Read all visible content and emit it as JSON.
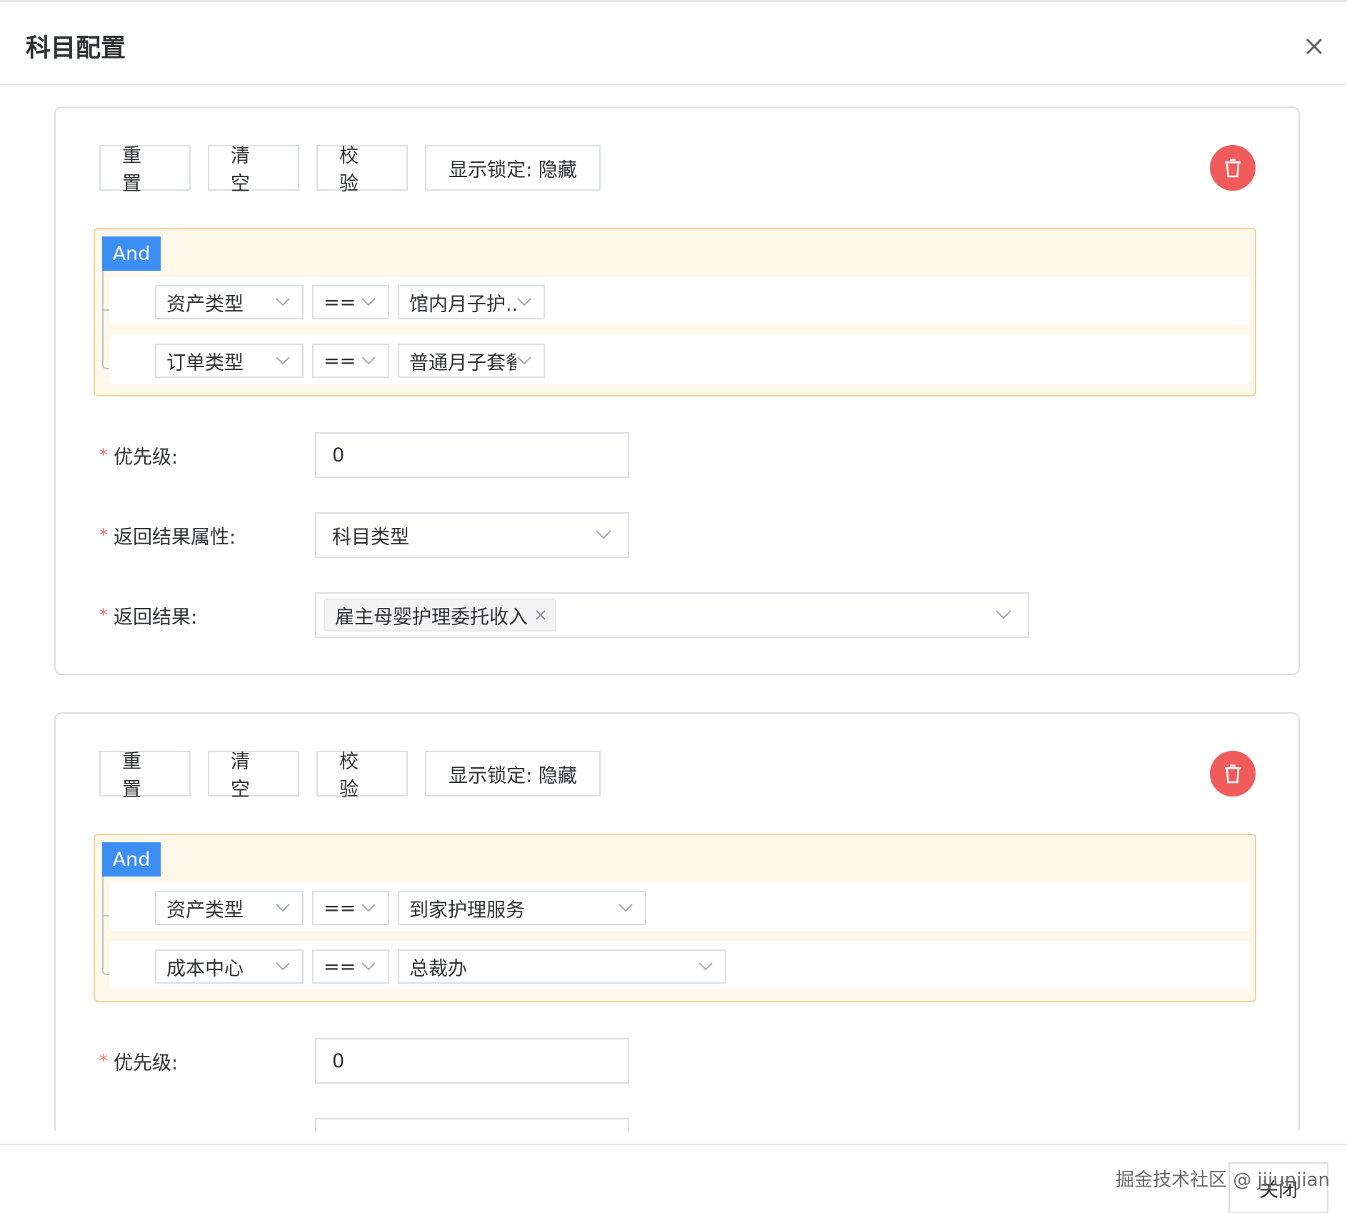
{
  "dialog": {
    "title": "科目配置",
    "close_button": "关闭",
    "watermark": "掘金技术社区 @ jijunjian"
  },
  "toolbar": {
    "reset": "重置",
    "clear": "清空",
    "validate": "校验",
    "lock_toggle": "显示锁定: 隐藏"
  },
  "form_labels": {
    "priority": "优先级:",
    "result_attr": "返回结果属性:",
    "result": "返回结果:",
    "required_mark": "*"
  },
  "cards": [
    {
      "logic": "And",
      "rules": [
        {
          "field": "资产类型",
          "op": "==",
          "value": "馆内月子护..."
        },
        {
          "field": "订单类型",
          "op": "==",
          "value": "普通月子套餐"
        }
      ],
      "priority": "0",
      "result_attr": "科目类型",
      "result_tag": "雇主母婴护理委托收入"
    },
    {
      "logic": "And",
      "rules": [
        {
          "field": "资产类型",
          "op": "==",
          "value": "到家护理服务"
        },
        {
          "field": "成本中心",
          "op": "==",
          "value": "总裁办"
        }
      ],
      "priority": "0"
    }
  ],
  "colors": {
    "accent": "#3d8ef2",
    "danger": "#f05c5c",
    "rule_bg": "#fdf8e9",
    "rule_border": "#eed397"
  }
}
